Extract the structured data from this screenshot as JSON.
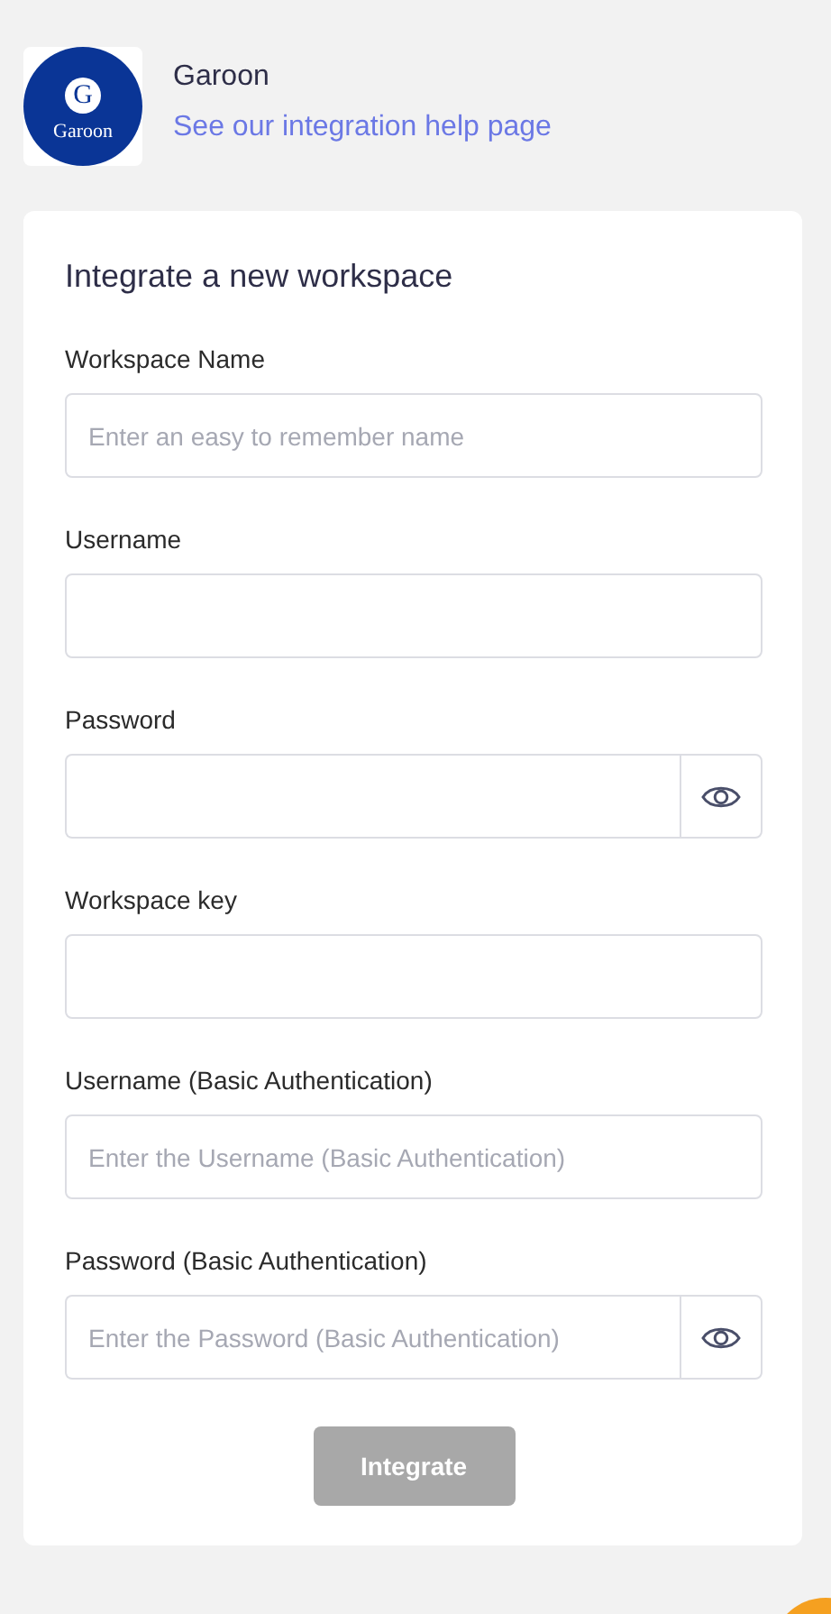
{
  "app": {
    "logo": {
      "letter": "G",
      "text": "Garoon"
    },
    "name": "Garoon",
    "help_link": "See our integration help page"
  },
  "form": {
    "title": "Integrate a new workspace",
    "fields": [
      {
        "label": "Workspace Name",
        "kind": "text",
        "placeholder": "Enter an easy to remember name"
      },
      {
        "label": "Username",
        "kind": "text"
      },
      {
        "label": "Password",
        "kind": "password"
      },
      {
        "label": "Workspace key",
        "kind": "text"
      },
      {
        "label": "Username (Basic Authentication)",
        "kind": "text",
        "placeholder": "Enter the Username (Basic Authentication)"
      },
      {
        "label": "Password (Basic Authentication)",
        "kind": "password",
        "placeholder": "Enter the Password (Basic Authentication)"
      }
    ],
    "submit": {
      "label": "Integrate",
      "disabled": true
    }
  }
}
